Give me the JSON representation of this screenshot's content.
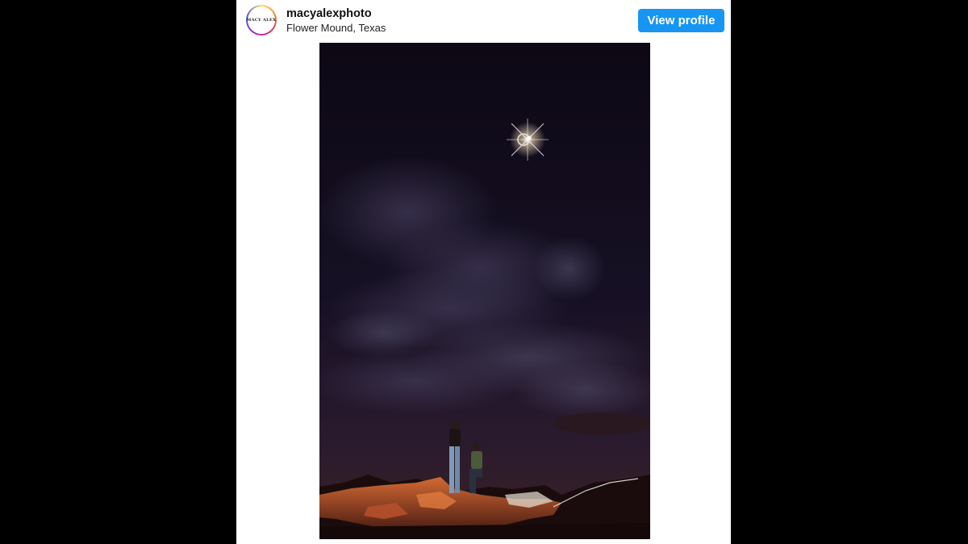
{
  "profile": {
    "avatar_text": "MACY ALEX",
    "username": "macyalexphoto",
    "location": "Flower Mound, Texas",
    "view_profile_label": "View profile"
  },
  "photo": {
    "subject": "couple-proposal-under-eclipse"
  },
  "colors": {
    "button": "#1795f2",
    "sky": "#120a1c",
    "rock": "#c0592b"
  }
}
